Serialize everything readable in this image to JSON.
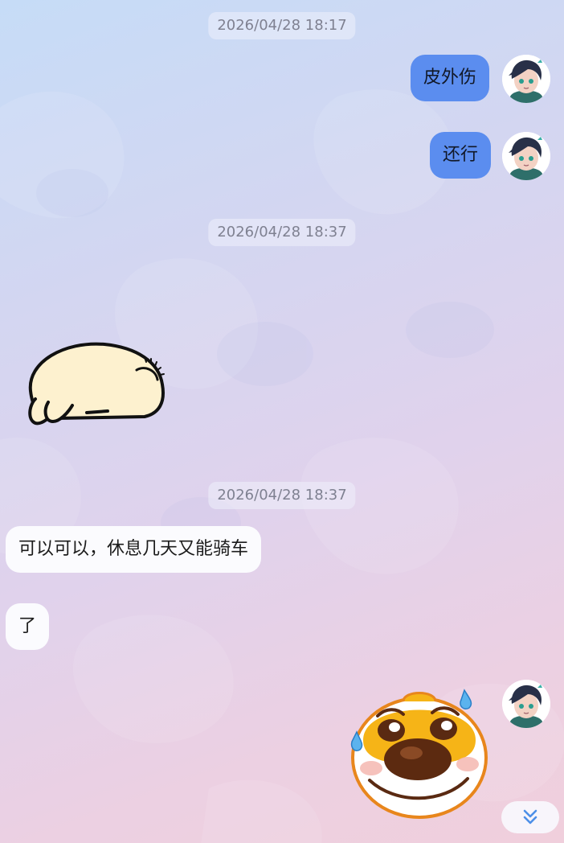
{
  "chat": {
    "timestamps": [
      "2026/04/28 18:17",
      "2026/04/28 18:37",
      "2026/04/28 18:37"
    ],
    "messages": {
      "sent_1": "皮外伤",
      "sent_2": "还行",
      "recv_1": "可以可以，休息几天又能骑车",
      "recv_2": "了"
    },
    "stickers": {
      "received": "lying-bunny-sticker",
      "sent": "crying-dog-emoji-sticker"
    }
  },
  "controls": {
    "scroll_to_bottom_icon": "double-chevron-down-icon"
  },
  "colors": {
    "sent_bubble": "#5b8def",
    "received_bubble": "#fbfbfe",
    "timestamp_text": "#7f8191",
    "scroll_icon": "#4d8fe8"
  }
}
